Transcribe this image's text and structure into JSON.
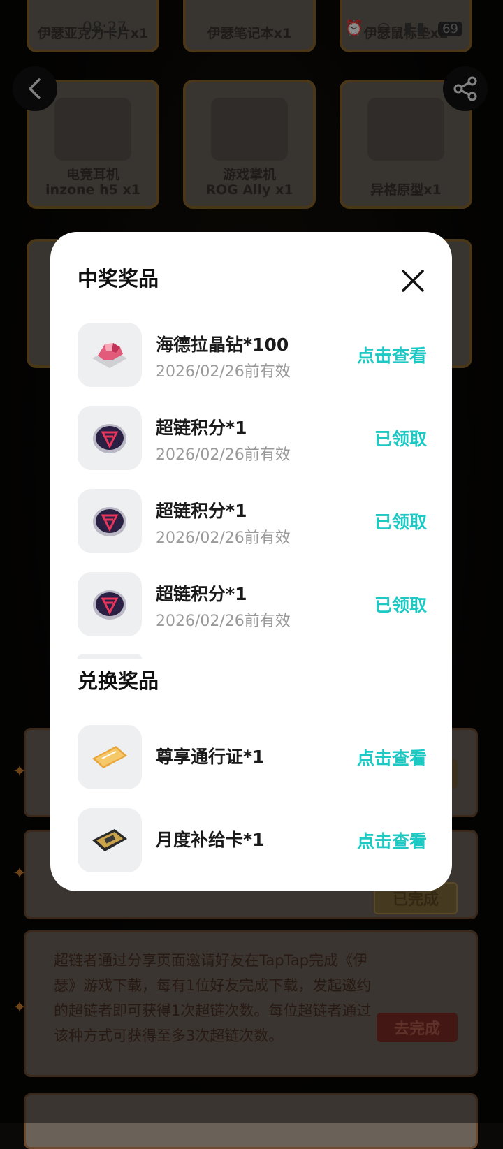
{
  "status_bar": {
    "time": "08:27",
    "battery": "69"
  },
  "background": {
    "prizes_row1": [
      "伊瑟亚克力卡片x1",
      "伊瑟笔记本x1",
      "伊瑟鼠标垫x1"
    ],
    "prizes_row2": [
      {
        "line1": "电竞耳机",
        "line2": "inzone h5  x1"
      },
      {
        "line1": "游戏掌机",
        "line2": "ROG Ally  x1"
      },
      {
        "line1": "",
        "line2": "异格原型x1"
      }
    ],
    "invite_task_text": "超链者通过分享页面邀请好友在TapTap完成《伊瑟》游戏下载，每有1位好友完成下载，发起邀约的超链者即可获得1次超链次数。每位超链者通过该种方式可获得至多3次超链次数。",
    "completed_label": "已完成",
    "go_complete_label": "去完成"
  },
  "modal": {
    "won_title": "中奖奖品",
    "won_items": [
      {
        "name": "海德拉晶钻*100",
        "date": "2026/02/26前有效",
        "action": "点击查看",
        "icon": "crystal-icon"
      },
      {
        "name": "超链积分*1",
        "date": "2026/02/26前有效",
        "action": "已领取",
        "icon": "points-coin-icon"
      },
      {
        "name": "超链积分*1",
        "date": "2026/02/26前有效",
        "action": "已领取",
        "icon": "points-coin-icon"
      },
      {
        "name": "超链积分*1",
        "date": "2026/02/26前有效",
        "action": "已领取",
        "icon": "points-coin-icon"
      }
    ],
    "exchange_title": "兑换奖品",
    "exchange_items": [
      {
        "name": "尊享通行证*1",
        "action": "点击查看",
        "icon": "pass-ticket-icon"
      },
      {
        "name": "月度补给卡*1",
        "action": "点击查看",
        "icon": "supply-card-icon"
      }
    ]
  },
  "colors": {
    "accent": "#1ec9c4",
    "title": "#111111",
    "muted": "#9a9a9a"
  }
}
